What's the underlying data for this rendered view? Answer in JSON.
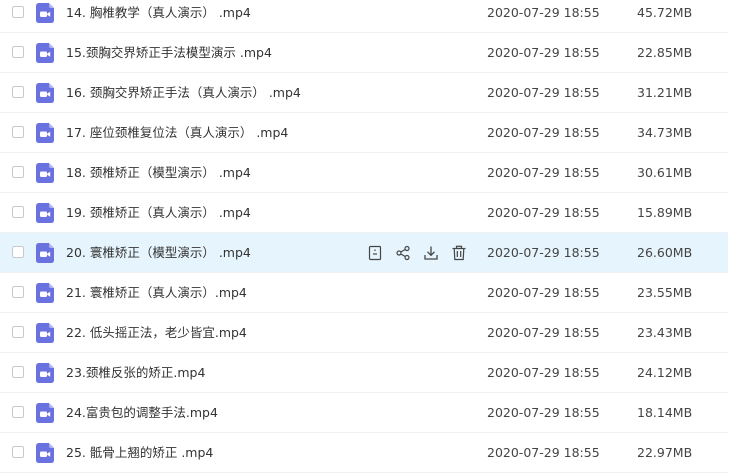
{
  "colors": {
    "file_icon": "#6a72e0",
    "hover_row": "#e6f5fd",
    "action_icon": "#454545"
  },
  "row_actions": [
    {
      "name": "file-info-icon"
    },
    {
      "name": "share-icon"
    },
    {
      "name": "download-icon"
    },
    {
      "name": "delete-icon"
    }
  ],
  "files": [
    {
      "name": "14. 胸椎教学（真人演示） .mp4",
      "date": "2020-07-29 18:55",
      "size": "45.72MB"
    },
    {
      "name": "15.颈胸交界矫正手法模型演示 .mp4",
      "date": "2020-07-29 18:55",
      "size": "22.85MB"
    },
    {
      "name": "16. 颈胸交界矫正手法（真人演示） .mp4",
      "date": "2020-07-29 18:55",
      "size": "31.21MB"
    },
    {
      "name": "17. 座位颈椎复位法（真人演示） .mp4",
      "date": "2020-07-29 18:55",
      "size": "34.73MB"
    },
    {
      "name": "18. 颈椎矫正（模型演示） .mp4",
      "date": "2020-07-29 18:55",
      "size": "30.61MB"
    },
    {
      "name": "19. 颈椎矫正（真人演示） .mp4",
      "date": "2020-07-29 18:55",
      "size": "15.89MB"
    },
    {
      "name": "20. 寰椎矫正（模型演示） .mp4",
      "date": "2020-07-29 18:55",
      "size": "26.60MB",
      "hover": true
    },
    {
      "name": "21. 寰椎矫正（真人演示）.mp4",
      "date": "2020-07-29 18:55",
      "size": "23.55MB"
    },
    {
      "name": "22. 低头摇正法，老少皆宜.mp4",
      "date": "2020-07-29 18:55",
      "size": "23.43MB"
    },
    {
      "name": "23.颈椎反张的矫正.mp4",
      "date": "2020-07-29 18:55",
      "size": "24.12MB"
    },
    {
      "name": "24.富贵包的调整手法.mp4",
      "date": "2020-07-29 18:55",
      "size": "18.14MB"
    },
    {
      "name": "25. 骶骨上翘的矫正 .mp4",
      "date": "2020-07-29 18:55",
      "size": "22.97MB"
    }
  ]
}
